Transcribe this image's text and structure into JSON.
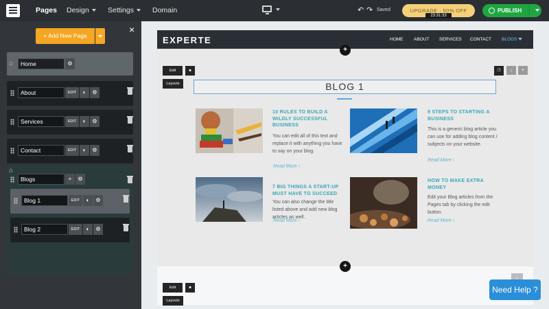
{
  "topbar": {
    "nav": [
      "Pages",
      "Design",
      "Settings",
      "Domain"
    ],
    "saved": "Saved",
    "upgrade": "UPGRADE · 50% OFF",
    "timer": "23:31:33",
    "publish": "PUBLISH"
  },
  "sidebar": {
    "add_page": "+ Add New Page",
    "close": "×",
    "edit_label": "EDIT",
    "pages": [
      {
        "name": "Home"
      },
      {
        "name": "About"
      },
      {
        "name": "Services"
      },
      {
        "name": "Contact"
      },
      {
        "name": "Blogs"
      },
      {
        "name": "Blog 1"
      },
      {
        "name": "Blog 2"
      }
    ]
  },
  "site": {
    "brand": "EXPERTE",
    "nav": [
      "HOME",
      "ABOUT",
      "SERVICES",
      "CONTACT",
      "BLOGS"
    ],
    "edit": "Edit",
    "layouts": "Layouts",
    "section_title": "BLOG 1",
    "read_more": "Read More ›",
    "posts": [
      {
        "title": "10 RULES TO BUILD A WILDLY SUCCESSFUL BUSINESS",
        "body": "You can edit all of this text and replace it with anything you have to say on your blog."
      },
      {
        "title": "9 STEPS TO STARTING A BUSINESS",
        "body": "This is a generic blog article you can use for adding blog content / subjects on your website."
      },
      {
        "title": "7 BIG THINGS A START-UP MUST HAVE TO SUCCEED",
        "body": "You can also change the title listed above and add new blog articles as well."
      },
      {
        "title": "HOW TO MAKE EXTRA MONEY",
        "body": "Edit your Blog articles from the Pages tab by clicking the edit button."
      }
    ]
  },
  "help": "Need Help ?"
}
